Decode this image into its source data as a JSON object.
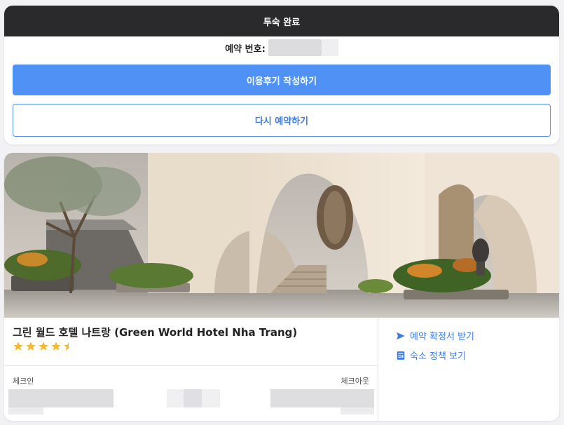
{
  "top": {
    "header_title": "투숙 완료",
    "booking_label": "예약 번호:",
    "review_button": "이용후기 작성하기",
    "rebook_button": "다시 예약하기"
  },
  "hotel": {
    "name": "그린 월드 호텔 나트랑 (Green World Hotel Nha Trang)",
    "rating_stars": 4.5,
    "checkin_label": "체크인",
    "checkout_label": "체크아웃",
    "actions": [
      {
        "label": "예약 확정서 받기",
        "icon": "send-icon"
      },
      {
        "label": "숙소 정책 보기",
        "icon": "document-icon"
      }
    ]
  },
  "colors": {
    "primary": "#5091f5",
    "link": "#3d7ee6",
    "header_bg": "#2a2a2c",
    "star": "#f5b82e"
  }
}
